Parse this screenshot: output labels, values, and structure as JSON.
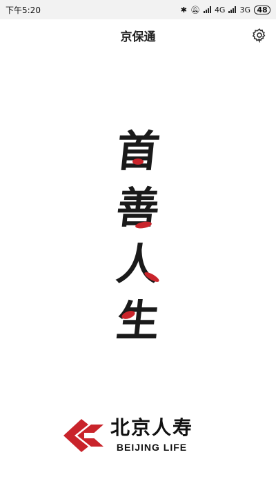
{
  "status_bar": {
    "time": "下午5:20",
    "network_primary": "4G",
    "network_secondary": "3G",
    "battery": "48"
  },
  "header": {
    "title": "京保通",
    "settings_icon": "gear-icon"
  },
  "slogan": {
    "characters": [
      "首",
      "善",
      "人",
      "生"
    ],
    "accent_color": "#c9242b"
  },
  "logo": {
    "chinese_name": "北京人寿",
    "english_name": "BEIJING LIFE",
    "brand_color": "#c9242b"
  }
}
